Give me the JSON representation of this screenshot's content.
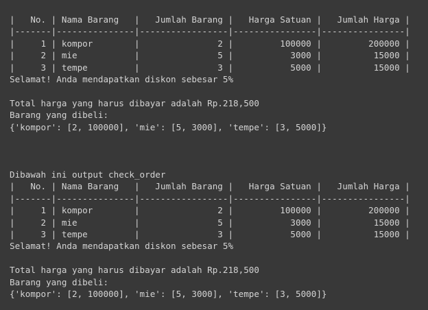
{
  "output": {
    "block1": [
      "|   No. | Nama Barang   |   Jumlah Barang |   Harga Satuan |   Jumlah Harga |",
      "|-------|---------------|-----------------|----------------|----------------|",
      "|     1 | kompor        |               2 |         100000 |         200000 |",
      "|     2 | mie           |               5 |           3000 |          15000 |",
      "|     3 | tempe         |               3 |           5000 |          15000 |",
      "Selamat! Anda mendapatkan diskon sebesar 5%",
      "",
      "Total harga yang harus dibayar adalah Rp.218,500",
      "Barang yang dibeli:",
      "{'kompor': [2, 100000], 'mie': [5, 3000], 'tempe': [3, 5000]}"
    ],
    "block2": [
      "Dibawah ini output check_order",
      "|   No. | Nama Barang   |   Jumlah Barang |   Harga Satuan |   Jumlah Harga |",
      "|-------|---------------|-----------------|----------------|----------------|",
      "|     1 | kompor        |               2 |         100000 |         200000 |",
      "|     2 | mie           |               5 |           3000 |          15000 |",
      "|     3 | tempe         |               3 |           5000 |          15000 |",
      "Selamat! Anda mendapatkan diskon sebesar 5%",
      "",
      "Total harga yang harus dibayar adalah Rp.218,500",
      "Barang yang dibeli:",
      "{'kompor': [2, 100000], 'mie': [5, 3000], 'tempe': [3, 5000]}"
    ]
  }
}
